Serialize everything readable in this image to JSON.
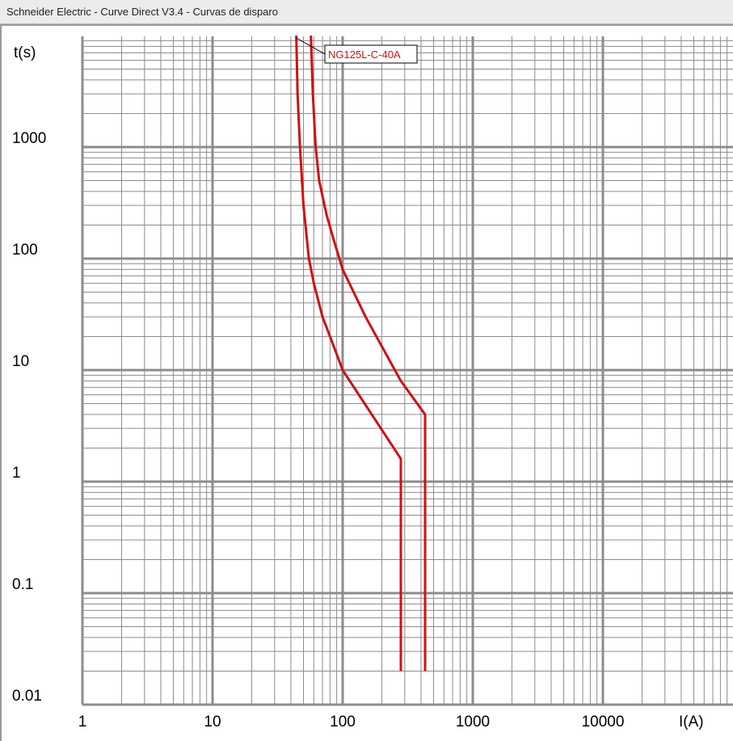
{
  "window": {
    "title": "Schneider Electric - Curve Direct V3.4 - Curvas de disparo"
  },
  "chart_data": {
    "type": "line",
    "xscale": "log",
    "yscale": "log",
    "xlim": [
      1,
      10000
    ],
    "ylim": [
      0.01,
      10000
    ],
    "xlabel": "I(A)",
    "ylabel": "t(s)",
    "x_ticks": [
      "1",
      "10",
      "100",
      "1000",
      "10000"
    ],
    "y_ticks": [
      "0.01",
      "0.1",
      "1",
      "10",
      "100",
      "1000"
    ],
    "grid": true,
    "colors": {
      "grid": "#8c8c8c",
      "curve": "#d01010",
      "callout": "#d01010"
    },
    "annotation": "NG125L-C-40A",
    "series": [
      {
        "x": [
          44,
          45,
          47,
          50,
          55,
          60,
          70,
          80,
          100,
          280,
          280
        ],
        "y": [
          10000,
          3000,
          1000,
          300,
          100,
          60,
          30,
          20,
          10,
          1.6,
          0.02
        ]
      },
      {
        "x": [
          57,
          59,
          62,
          66,
          75,
          85,
          100,
          150,
          280,
          430,
          430
        ],
        "y": [
          10000,
          3000,
          1000,
          500,
          250,
          150,
          80,
          30,
          8,
          4,
          0.02
        ]
      }
    ]
  }
}
